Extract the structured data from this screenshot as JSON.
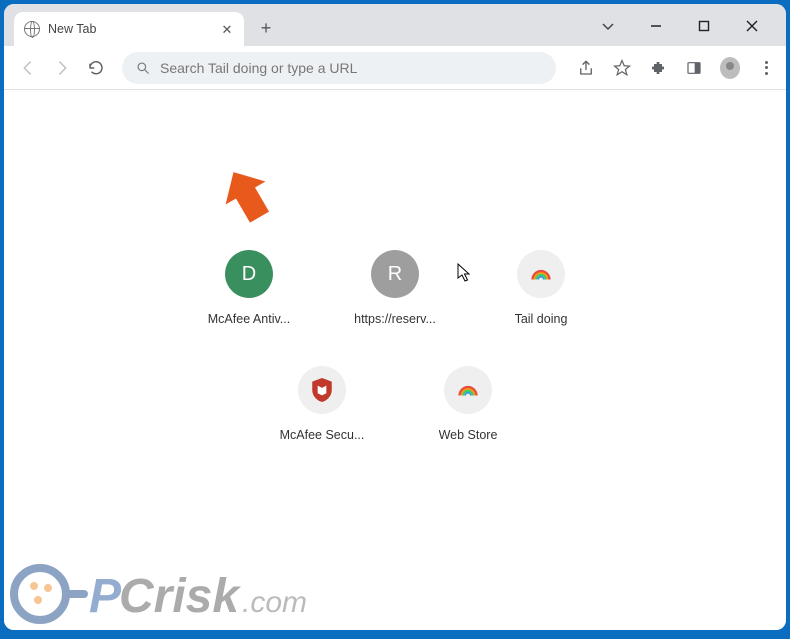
{
  "tab": {
    "title": "New Tab"
  },
  "omnibox": {
    "placeholder": "Search Tail doing or type a URL"
  },
  "shortcuts": {
    "row1": [
      {
        "label": "McAfee Antiv...",
        "badge": "D",
        "style": "badge-d"
      },
      {
        "label": "https://reserv...",
        "badge": "R",
        "style": "badge-r"
      },
      {
        "label": "Tail doing",
        "badge": "",
        "style": "rainbow"
      }
    ],
    "row2": [
      {
        "label": "McAfee Secu...",
        "badge": "",
        "style": "mcafee"
      },
      {
        "label": "Web Store",
        "badge": "",
        "style": "rainbow"
      }
    ]
  },
  "watermark": {
    "text": "PCrisk.com"
  }
}
